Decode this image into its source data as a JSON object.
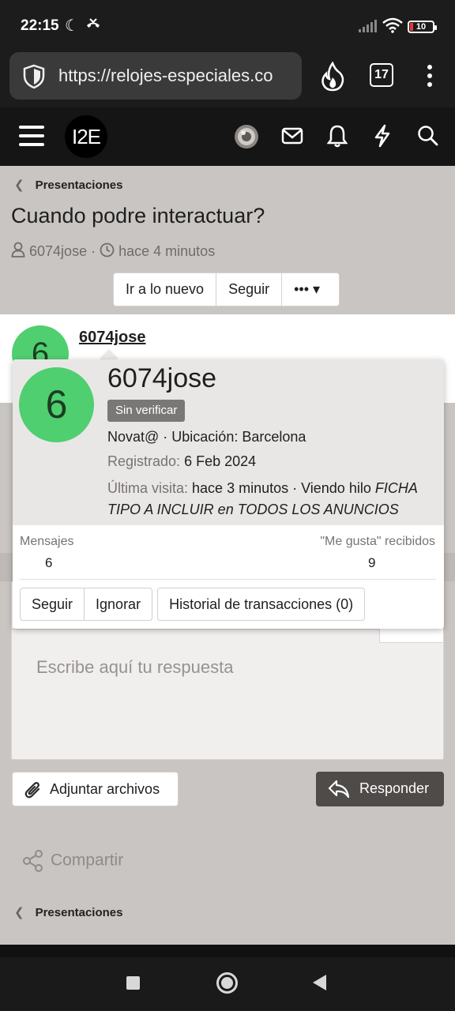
{
  "status_bar": {
    "time": "22:15",
    "battery": "10"
  },
  "browser": {
    "url": "https://relojes-especiales.co",
    "tab_count": "17"
  },
  "site_header": {
    "logo": "I2E"
  },
  "breadcrumb": {
    "label": "Presentaciones"
  },
  "thread": {
    "title": "Cuando podre interactuar?",
    "author": "6074jose",
    "time": "hace 4 minutos",
    "buttons": {
      "new": "Ir a lo nuevo",
      "follow": "Seguir",
      "more": "•••"
    }
  },
  "post": {
    "avatar_letter": "6",
    "username": "6074jose"
  },
  "member_card": {
    "avatar_letter": "6",
    "name": "6074jose",
    "badge": "Sin verificar",
    "role_location": "Novat@ · Ubicación: Barcelona",
    "registered_label": "Registrado:",
    "registered_value": "6 Feb 2024",
    "last_seen_label": "Última visita:",
    "last_seen_value": "hace 3 minutos · Viendo hilo",
    "last_seen_thread": "FICHA TIPO A INCLUIR en TODOS LOS ANUNCIOS",
    "messages_label": "Mensajes",
    "messages_value": "6",
    "likes_label": "\"Me gusta\" recibidos",
    "likes_value": "9",
    "follow_button": "Seguir",
    "ignore_button": "Ignorar",
    "history_button": "Historial de transacciones (0)"
  },
  "reply": {
    "placeholder": "Escribe aquí tu respuesta",
    "attach_label": "Adjuntar archivos",
    "submit_label": "Responder"
  },
  "share": {
    "label": "Compartir"
  },
  "breadcrumb_bottom": {
    "label": "Presentaciones"
  }
}
